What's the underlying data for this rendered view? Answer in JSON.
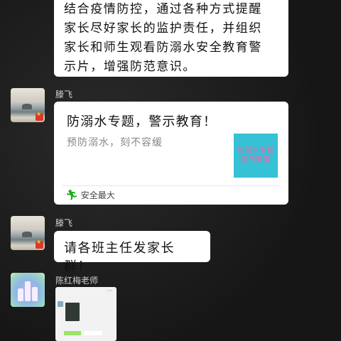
{
  "messages": {
    "top_text_lines": [
      "结合疫情防控，通过各种方式提醒",
      "家长尽好家长的监护责任，并组织",
      "家长和师生观看防溺水安全教育警",
      "示片，增强防范意识。"
    ],
    "sender1": {
      "name": "滕飞"
    },
    "card": {
      "title": "防溺水专题，警示教育！",
      "description": "预防溺水，刻不容缓",
      "thumb_lines": [
        "防溺水专题",
        "警示教育"
      ],
      "source": "安全最大",
      "source_icon": "runner-icon"
    },
    "sender2": {
      "name": "滕飞",
      "text": "请各班主任发家长群！"
    },
    "sender3": {
      "name": "陈红梅老师"
    },
    "shot": {
      "dots": "···"
    }
  },
  "colors": {
    "background": "#1c1c1c",
    "bubble": "#ffffff",
    "thumb": "#35c1d6",
    "thumb_text": "#ff5fa6",
    "wechat_green": "#1aad19"
  }
}
